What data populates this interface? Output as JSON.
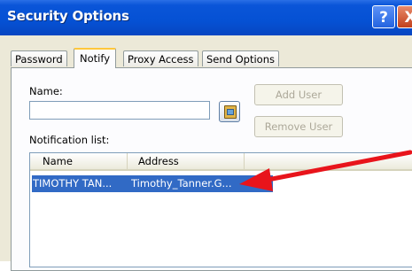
{
  "window": {
    "title": "Security Options",
    "help_label": "?",
    "close_label": "X"
  },
  "tabs": [
    {
      "label": "Password",
      "active": false
    },
    {
      "label": "Notify",
      "active": true
    },
    {
      "label": "Proxy Access",
      "active": false
    },
    {
      "label": "Send Options",
      "active": false
    }
  ],
  "notify": {
    "name_label": "Name:",
    "name_value": "",
    "add_user_label": "Add User",
    "remove_user_label": "Remove User",
    "list_label": "Notification list:",
    "columns": [
      "Name",
      "Address"
    ],
    "rows": [
      {
        "name": "TIMOTHY TAN...",
        "address": "Timothy_Tanner.G...",
        "selected": true
      }
    ]
  },
  "colors": {
    "titlebar": "#0551d4",
    "selection": "#316ac5",
    "annotation_arrow": "#e8141b"
  },
  "icons": {
    "address_book": "address-book-icon"
  }
}
